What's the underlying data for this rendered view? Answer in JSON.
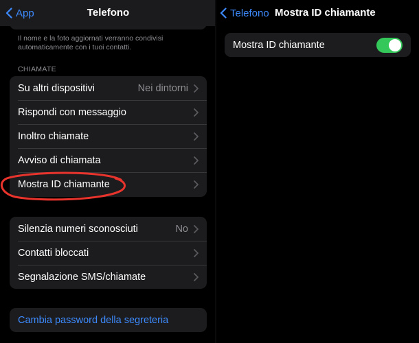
{
  "left": {
    "nav": {
      "back_label": "App",
      "title": "Telefono"
    },
    "footer_note": "Il nome e la foto aggiornati verranno condivisi automaticamente con i tuoi contatti.",
    "section_header": "CHIAMATE",
    "calls_group": [
      {
        "label": "Su altri dispositivi",
        "value": "Nei dintorni"
      },
      {
        "label": "Rispondi con messaggio",
        "value": ""
      },
      {
        "label": "Inoltro chiamate",
        "value": ""
      },
      {
        "label": "Avviso di chiamata",
        "value": ""
      },
      {
        "label": "Mostra ID chiamante",
        "value": ""
      }
    ],
    "blocking_group": [
      {
        "label": "Silenzia numeri sconosciuti",
        "value": "No"
      },
      {
        "label": "Contatti bloccati",
        "value": ""
      },
      {
        "label": "Segnalazione SMS/chiamate",
        "value": ""
      }
    ],
    "voicemail_link": "Cambia password della segreteria"
  },
  "right": {
    "nav": {
      "back_label": "Telefono",
      "title": "Mostra ID chiamante"
    },
    "setting": {
      "label": "Mostra ID chiamante",
      "enabled": true
    }
  },
  "colors": {
    "accent": "#3d8bff",
    "toggle_on": "#34c759",
    "annotation": "#e8342c",
    "card_bg": "#1c1c1e"
  },
  "icons": {
    "back": "chevron-left-icon",
    "disclosure": "chevron-right-icon"
  }
}
